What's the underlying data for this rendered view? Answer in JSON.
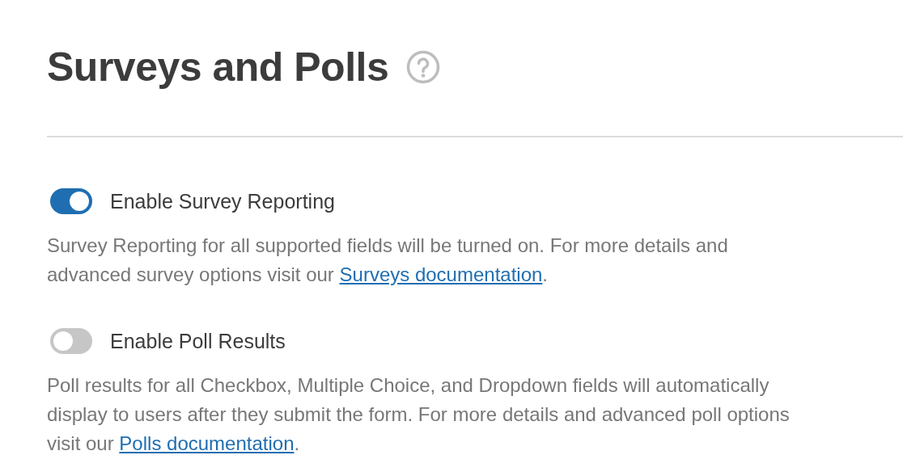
{
  "title": "Surveys and Polls",
  "settings": [
    {
      "label": "Enable Survey Reporting",
      "on": true,
      "description": "Survey Reporting for all supported fields will be turned on. For more details and advanced survey options visit our",
      "link": "Surveys documentation",
      "after_link": "."
    },
    {
      "label": "Enable Poll Results",
      "on": false,
      "description": "Poll results for all Checkbox, Multiple Choice, and Dropdown fields will automatically display to users after they submit the form. For more details and advanced poll options visit our",
      "link": "Polls documentation",
      "after_link": "."
    }
  ]
}
